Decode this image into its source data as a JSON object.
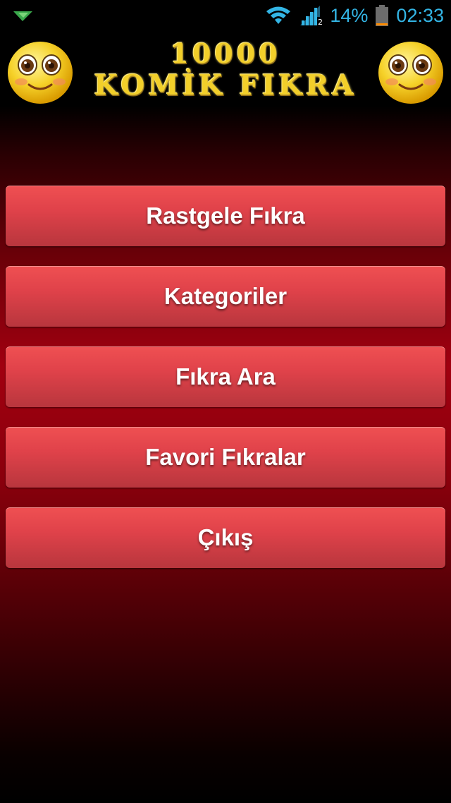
{
  "status_bar": {
    "battery_percent": "14%",
    "time": "02:33",
    "icons": [
      "notification-icon",
      "wifi-icon",
      "signal-icon",
      "battery-icon"
    ],
    "color": "#33b5e5"
  },
  "header": {
    "logo_line1": "10000",
    "logo_line2": "KOMİK FIKRA",
    "logo_color": "#f2cf2a"
  },
  "menu": {
    "items": [
      {
        "label": "Rastgele Fıkra"
      },
      {
        "label": "Kategoriler"
      },
      {
        "label": "Fıkra Ara"
      },
      {
        "label": "Favori Fıkralar"
      },
      {
        "label": "Çıkış"
      }
    ],
    "button_color": "#e0424a",
    "text_color": "#ffffff"
  }
}
